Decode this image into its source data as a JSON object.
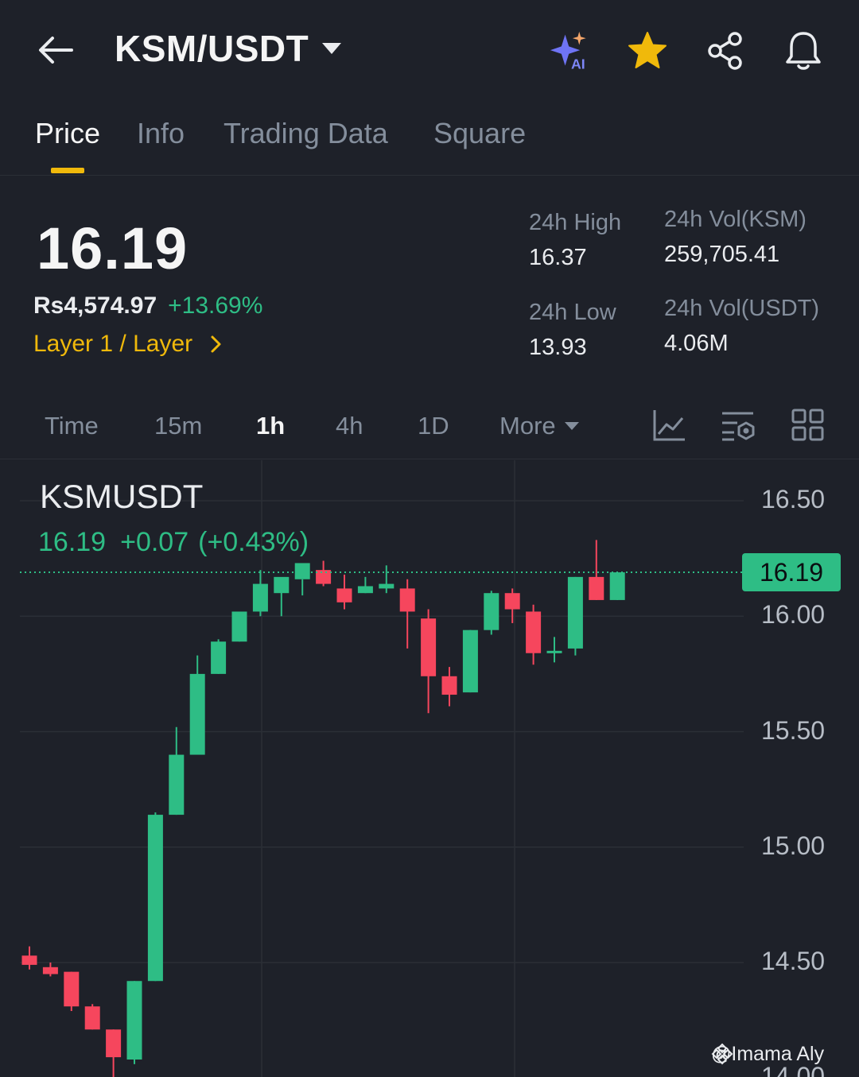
{
  "header": {
    "title": "KSM/USDT",
    "icons": [
      "back-arrow-icon",
      "ai-sparkle-icon",
      "star-icon",
      "share-icon",
      "bell-icon"
    ],
    "ai_label": "AI"
  },
  "tabs": [
    "Price",
    "Info",
    "Trading Data",
    "Square"
  ],
  "active_tab": "Price",
  "ticker": {
    "last_price": "16.19",
    "fiat_price": "Rs4,574.97",
    "change_pct": "+13.69%",
    "tag": "Layer 1 / Layer",
    "high_label": "24h High",
    "high_value": "16.37",
    "low_label": "24h Low",
    "low_value": "13.93",
    "vol_base_label": "24h Vol(KSM)",
    "vol_base_value": "259,705.41",
    "vol_quote_label": "24h Vol(USDT)",
    "vol_quote_value": "4.06M"
  },
  "intervals": [
    "Time",
    "15m",
    "1h",
    "4h",
    "1D",
    "More"
  ],
  "active_interval": "1h",
  "chart": {
    "symbol": "KSMUSDT",
    "info_price": "16.19",
    "info_change": "+0.07",
    "info_change_pct": "(+0.43%)",
    "current_price_badge": "16.19",
    "watermark": "@Imama Aly"
  },
  "colors": {
    "up": "#2ebd85",
    "down": "#f6465d",
    "accent": "#f0b90b",
    "background": "#1e2129"
  },
  "chart_data": {
    "type": "candlestick",
    "y_ticks": [
      "16.50",
      "16.00",
      "15.50",
      "15.00",
      "14.50",
      "14.00"
    ],
    "ylim": [
      14.0,
      16.5
    ],
    "current_price": 16.19,
    "grid": true,
    "candles": [
      {
        "o": 14.53,
        "h": 14.57,
        "l": 14.47,
        "c": 14.49
      },
      {
        "o": 14.48,
        "h": 14.5,
        "l": 14.44,
        "c": 14.45
      },
      {
        "o": 14.46,
        "h": 14.46,
        "l": 14.29,
        "c": 14.31
      },
      {
        "o": 14.31,
        "h": 14.32,
        "l": 14.21,
        "c": 14.21
      },
      {
        "o": 14.21,
        "h": 14.21,
        "l": 14.0,
        "c": 14.09
      },
      {
        "o": 14.08,
        "h": 14.42,
        "l": 14.06,
        "c": 14.42
      },
      {
        "o": 14.42,
        "h": 15.15,
        "l": 14.42,
        "c": 15.14
      },
      {
        "o": 15.14,
        "h": 15.52,
        "l": 15.14,
        "c": 15.4
      },
      {
        "o": 15.4,
        "h": 15.83,
        "l": 15.4,
        "c": 15.75
      },
      {
        "o": 15.75,
        "h": 15.9,
        "l": 15.75,
        "c": 15.89
      },
      {
        "o": 15.89,
        "h": 16.0,
        "l": 15.89,
        "c": 16.02
      },
      {
        "o": 16.02,
        "h": 16.2,
        "l": 16.0,
        "c": 16.14
      },
      {
        "o": 16.1,
        "h": 16.16,
        "l": 16.0,
        "c": 16.17
      },
      {
        "o": 16.16,
        "h": 16.16,
        "l": 16.09,
        "c": 16.23
      },
      {
        "o": 16.2,
        "h": 16.24,
        "l": 16.13,
        "c": 16.14
      },
      {
        "o": 16.12,
        "h": 16.18,
        "l": 16.03,
        "c": 16.06
      },
      {
        "o": 16.1,
        "h": 16.17,
        "l": 16.1,
        "c": 16.13
      },
      {
        "o": 16.12,
        "h": 16.22,
        "l": 16.1,
        "c": 16.14
      },
      {
        "o": 16.12,
        "h": 16.16,
        "l": 15.86,
        "c": 16.02
      },
      {
        "o": 15.99,
        "h": 16.03,
        "l": 15.58,
        "c": 15.74
      },
      {
        "o": 15.74,
        "h": 15.78,
        "l": 15.61,
        "c": 15.66
      },
      {
        "o": 15.67,
        "h": 15.94,
        "l": 15.67,
        "c": 15.94
      },
      {
        "o": 15.94,
        "h": 16.11,
        "l": 15.92,
        "c": 16.1
      },
      {
        "o": 16.1,
        "h": 16.12,
        "l": 15.97,
        "c": 16.03
      },
      {
        "o": 16.02,
        "h": 16.05,
        "l": 15.79,
        "c": 15.84
      },
      {
        "o": 15.85,
        "h": 15.91,
        "l": 15.8,
        "c": 15.85
      },
      {
        "o": 15.86,
        "h": 16.17,
        "l": 15.83,
        "c": 16.17
      },
      {
        "o": 16.17,
        "h": 16.33,
        "l": 16.07,
        "c": 16.07
      },
      {
        "o": 16.07,
        "h": 16.19,
        "l": 16.07,
        "c": 16.19
      }
    ]
  }
}
